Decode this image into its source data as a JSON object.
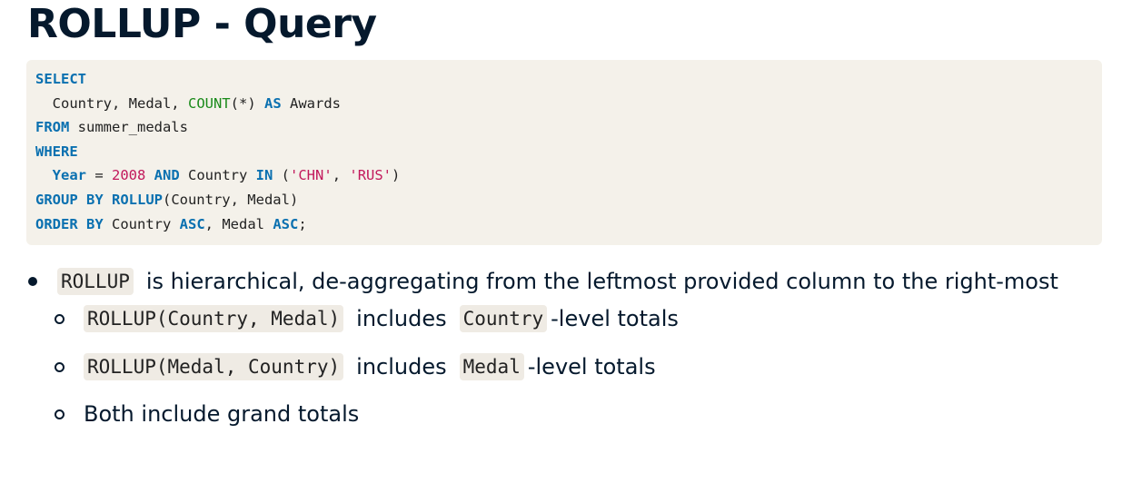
{
  "title": "ROLLUP - Query",
  "code": {
    "l1": {
      "kw1": "SELECT"
    },
    "l2": {
      "t1": "  Country, Medal, ",
      "fn1": "COUNT",
      "t2": "(*) ",
      "kw1": "AS",
      "t3": " Awards"
    },
    "l3": {
      "kw1": "FROM",
      "t1": " summer_medals"
    },
    "l4": {
      "kw1": "WHERE"
    },
    "l5": {
      "t0": "  ",
      "kw1": "Year",
      "t1": " = ",
      "num1": "2008",
      "t2": " ",
      "kw2": "AND",
      "t3": " Country ",
      "kw3": "IN",
      "t4": " (",
      "str1": "'CHN'",
      "t5": ", ",
      "str2": "'RUS'",
      "t6": ")"
    },
    "l6": {
      "kw1": "GROUP BY ROLLUP",
      "t1": "(Country, Medal)"
    },
    "l7": {
      "kw1": "ORDER BY",
      "t1": " Country ",
      "kw2": "ASC",
      "t2": ", Medal ",
      "kw3": "ASC",
      "t3": ";"
    }
  },
  "bullets": {
    "b1": {
      "code": "ROLLUP",
      "text": "is hierarchical, de-aggregating from the leftmost provided column to the right-most"
    },
    "s1": {
      "code1": "ROLLUP(Country, Medal)",
      "mid": "includes",
      "code2": "Country",
      "text": "-level totals"
    },
    "s2": {
      "code1": "ROLLUP(Medal, Country)",
      "mid": "includes",
      "code2": "Medal",
      "text": "-level totals"
    },
    "s3": {
      "text": "Both include grand totals"
    }
  }
}
